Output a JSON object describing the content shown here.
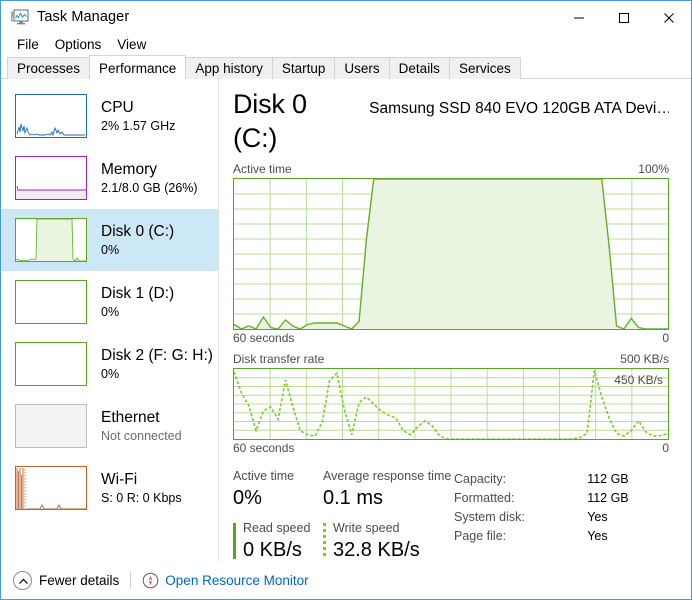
{
  "window": {
    "title": "Task Manager",
    "icon": "task-manager-icon",
    "minimize": "—",
    "maximize": "☐",
    "close": "✕"
  },
  "menu": [
    {
      "label": "File"
    },
    {
      "label": "Options"
    },
    {
      "label": "View"
    }
  ],
  "tabs": [
    {
      "label": "Processes",
      "active": false
    },
    {
      "label": "Performance",
      "active": true
    },
    {
      "label": "App history",
      "active": false
    },
    {
      "label": "Startup",
      "active": false
    },
    {
      "label": "Users",
      "active": false
    },
    {
      "label": "Details",
      "active": false
    },
    {
      "label": "Services",
      "active": false
    }
  ],
  "sidebar": {
    "items": [
      {
        "title": "CPU",
        "sub": "2%  1.57 GHz",
        "selected": false,
        "color": "#1f6fb4",
        "thumb": "cpu"
      },
      {
        "title": "Memory",
        "sub": "2.1/8.0 GB (26%)",
        "selected": false,
        "color": "#9b29b4",
        "thumb": "memory"
      },
      {
        "title": "Disk 0 (C:)",
        "sub": "0%",
        "selected": true,
        "color": "#59a524",
        "thumb": "disk0"
      },
      {
        "title": "Disk 1 (D:)",
        "sub": "0%",
        "selected": false,
        "color": "#59a524",
        "thumb": "empty"
      },
      {
        "title": "Disk 2 (F: G: H:)",
        "sub": "0%",
        "selected": false,
        "color": "#59a524",
        "thumb": "empty"
      },
      {
        "title": "Ethernet",
        "sub": "Not connected",
        "selected": false,
        "color": "#b0b0b0",
        "thumb": "disabled"
      },
      {
        "title": "Wi-Fi",
        "sub": "S: 0 R: 0 Kbps",
        "selected": false,
        "color": "#c0622a",
        "thumb": "wifi"
      }
    ]
  },
  "main": {
    "title": "Disk 0 (C:)",
    "subtitle": "Samsung SSD 840 EVO 120GB ATA Devi…",
    "active_graph": {
      "label": "Active time",
      "max_label": "100%",
      "left_foot": "60 seconds",
      "right_foot": "0"
    },
    "rate_graph": {
      "label": "Disk transfer rate",
      "max_label": "500 KB/s",
      "annotation": "450 KB/s",
      "left_foot": "60 seconds",
      "right_foot": "0"
    },
    "stats": {
      "active_time": {
        "caption": "Active time",
        "value": "0%"
      },
      "avg_response": {
        "caption": "Average response time",
        "value": "0.1 ms"
      },
      "read_speed": {
        "caption": "Read speed",
        "value": "0 KB/s",
        "marker": "solid"
      },
      "write_speed": {
        "caption": "Write speed",
        "value": "32.8 KB/s",
        "marker": "dashed"
      }
    },
    "info": [
      {
        "key": "Capacity:",
        "value": "112 GB"
      },
      {
        "key": "Formatted:",
        "value": "112 GB"
      },
      {
        "key": "System disk:",
        "value": "Yes"
      },
      {
        "key": "Page file:",
        "value": "Yes"
      }
    ]
  },
  "footer": {
    "fewer_details": "Fewer details",
    "fewer_icon": "chevron-up-circle-icon",
    "resource_monitor": "Open Resource Monitor",
    "resource_icon": "resource-monitor-icon"
  },
  "colors": {
    "accent_green": "#59a524",
    "fill_green": "#eaf5e1",
    "bright_green": "#7ccc2e",
    "grid_green": "#b9dd9c",
    "selection_blue": "#cce8f7",
    "link_blue": "#0066cc"
  },
  "chart_data": [
    {
      "type": "area",
      "name": "active-time-graph",
      "title": "Active time",
      "ylabel": "",
      "xlabel": "60 seconds",
      "ylim": [
        0,
        100
      ],
      "xlim": [
        60,
        0
      ],
      "grid": true,
      "grid_cols": 12,
      "grid_rows": 10,
      "values": [
        3,
        0,
        2,
        0,
        8,
        1,
        0,
        6,
        2,
        0,
        3,
        4,
        4,
        4,
        4,
        2,
        0,
        5,
        60,
        100,
        100,
        100,
        100,
        100,
        100,
        100,
        100,
        100,
        100,
        100,
        100,
        100,
        100,
        100,
        100,
        100,
        100,
        100,
        100,
        100,
        100,
        100,
        100,
        100,
        100,
        100,
        100,
        100,
        100,
        100,
        100,
        55,
        2,
        0,
        7,
        1,
        0,
        0,
        0,
        0
      ]
    },
    {
      "type": "line",
      "name": "disk-transfer-rate-graph",
      "title": "Disk transfer rate",
      "ylabel": "KB/s",
      "xlabel": "60 seconds",
      "ylim": [
        0,
        500
      ],
      "xlim": [
        60,
        0
      ],
      "annotation": "450 KB/s",
      "grid": true,
      "grid_cols": 12,
      "grid_rows": 8,
      "values": [
        480,
        330,
        240,
        60,
        200,
        230,
        140,
        420,
        230,
        60,
        30,
        20,
        120,
        420,
        470,
        210,
        30,
        260,
        300,
        250,
        200,
        170,
        150,
        60,
        30,
        90,
        130,
        90,
        20,
        0,
        0,
        0,
        0,
        0,
        0,
        0,
        0,
        0,
        0,
        0,
        0,
        0,
        0,
        0,
        0,
        0,
        0,
        10,
        40,
        490,
        300,
        150,
        40,
        20,
        60,
        130,
        50,
        20,
        25,
        40
      ]
    }
  ]
}
